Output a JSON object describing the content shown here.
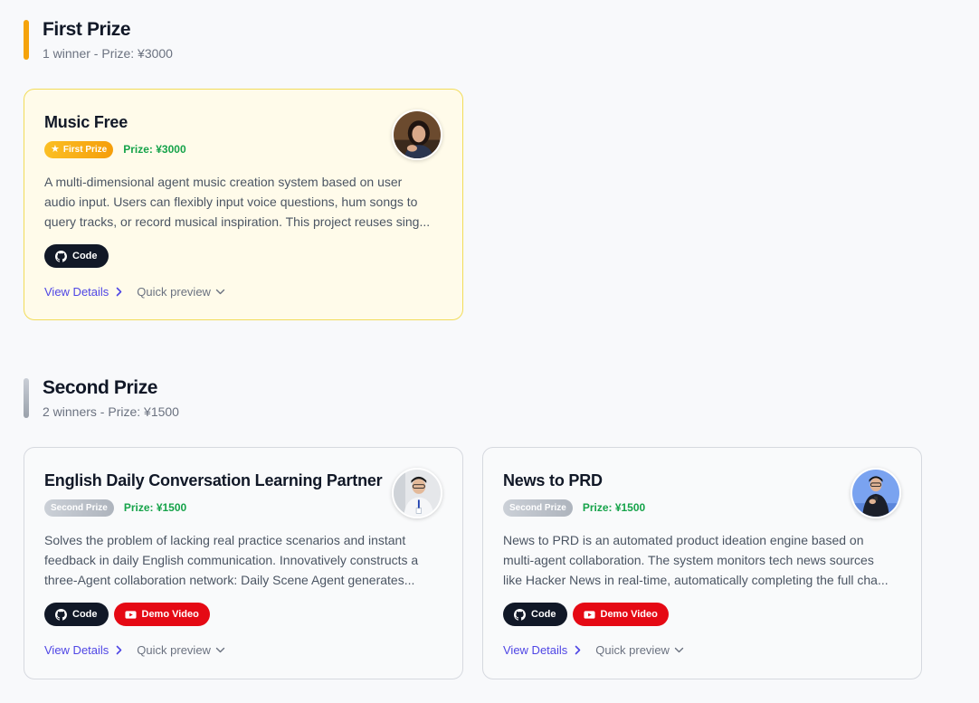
{
  "sections": [
    {
      "title": "First Prize",
      "subtitle": "1 winner - Prize: ¥3000",
      "accent": "#f5a30a",
      "cards": [
        {
          "title": "Music Free",
          "badge": "First Prize",
          "prize": "Prize: ¥3000",
          "desc_lines": [
            "A multi-dimensional agent music creation system based on user",
            "audio input. Users can flexibly input voice questions, hum songs to",
            "query tracks, or record musical inspiration. This project reuses sing..."
          ],
          "buttons": [
            "Code"
          ],
          "view_details": "View Details",
          "quick_preview": "Quick preview"
        }
      ]
    },
    {
      "title": "Second Prize",
      "subtitle": "2 winners - Prize: ¥1500",
      "accent": "#b0b6bf",
      "cards": [
        {
          "title": "English Daily Conversation Learning Partner",
          "badge": "Second Prize",
          "prize": "Prize: ¥1500",
          "desc_lines": [
            "Solves the problem of lacking real practice scenarios and instant",
            "feedback in daily English communication. Innovatively constructs a",
            "three-Agent collaboration network: Daily Scene Agent generates..."
          ],
          "buttons": [
            "Code",
            "Demo Video"
          ],
          "view_details": "View Details",
          "quick_preview": "Quick preview"
        },
        {
          "title": "News to PRD",
          "badge": "Second Prize",
          "prize": "Prize: ¥1500",
          "desc_lines": [
            "News to PRD is an automated product ideation engine based on",
            "multi-agent collaboration. The system monitors tech news sources",
            "like Hacker News in real-time, automatically completing the full cha..."
          ],
          "buttons": [
            "Code",
            "Demo Video"
          ],
          "view_details": "View Details",
          "quick_preview": "Quick preview"
        }
      ]
    }
  ],
  "icons": {
    "badge_first": "star-icon",
    "code_button": "github-icon",
    "demo_button": "youtube-icon",
    "view_details": "chevron-right-icon",
    "quick_preview": "chevron-down-icon"
  },
  "colors": {
    "link": "#4f46e5",
    "prize_green": "#16a34a",
    "gold_card_bg": "#fffbea",
    "gold_card_border": "#f2dc59",
    "demo_red": "#e50914",
    "code_dark": "#111827"
  }
}
